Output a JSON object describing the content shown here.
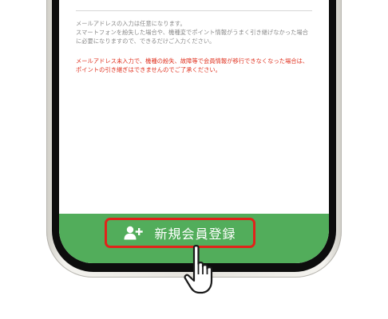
{
  "notes": {
    "gray": "メールアドレスの入力は任意になります。\nスマートフォンを紛失した場合や、機種変でポイント情報がうまく引き継げなかった場合に必要になりますので、できるだけご入力ください。",
    "red": "メールアドレス未入力で、機種の紛失、故障等で会員情報が移行できなくなった場合は、ポイントの引き継ぎはできませんのでご了承ください。"
  },
  "actions": {
    "register_label": "新規会員登録",
    "register_icon": "add-user-icon",
    "pointer_icon": "hand-pointer-icon"
  },
  "colors": {
    "accent_green": "#52ad5b",
    "highlight_red": "#e2231a",
    "warning_text": "#e0301e"
  }
}
